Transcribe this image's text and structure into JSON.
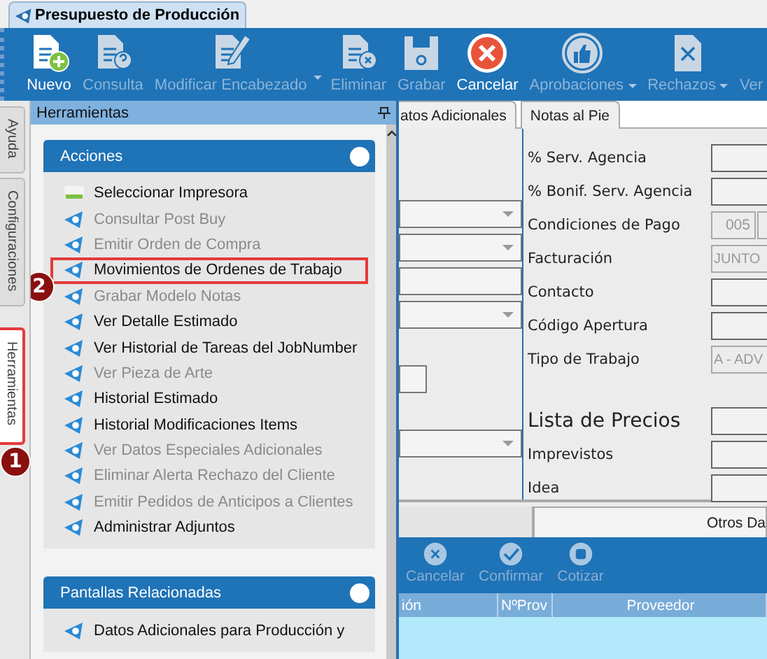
{
  "document_tab": {
    "title": "Presupuesto de Producción"
  },
  "toolbar": [
    {
      "label": "Nuevo",
      "kind": "new",
      "disabled": false
    },
    {
      "label": "Consulta",
      "kind": "query",
      "disabled": true
    },
    {
      "label": "Modificar Encabezado",
      "kind": "edit",
      "disabled": true,
      "split": true
    },
    {
      "label": "Eliminar",
      "kind": "delete",
      "disabled": true
    },
    {
      "label": "Grabar",
      "kind": "save",
      "disabled": true
    },
    {
      "label": "Cancelar",
      "kind": "cancel",
      "disabled": false
    },
    {
      "label": "Aprobaciones",
      "kind": "approve",
      "disabled": true,
      "dropdown": true
    },
    {
      "label": "Rechazos",
      "kind": "reject",
      "disabled": true,
      "dropdown": true
    },
    {
      "label": "Ver",
      "kind": "none",
      "disabled": true
    }
  ],
  "side_tabs": [
    {
      "label": "Ayuda",
      "selected": false
    },
    {
      "label": "Configuraciones",
      "selected": false
    },
    {
      "label": "Herramientas",
      "selected": true,
      "callout": "1"
    }
  ],
  "panel": {
    "title": "Herramientas",
    "sections": [
      {
        "title": "Acciones",
        "items": [
          {
            "label": "Seleccionar Impresora",
            "kind": "printer",
            "disabled": false
          },
          {
            "label": "Consultar Post Buy",
            "kind": "app",
            "disabled": true
          },
          {
            "label": "Emitir Orden de Compra",
            "kind": "app",
            "disabled": true
          },
          {
            "label": "Movimientos de Ordenes de Trabajo",
            "kind": "app",
            "disabled": false,
            "callout": "2"
          },
          {
            "label": "Grabar Modelo Notas",
            "kind": "app",
            "disabled": true
          },
          {
            "label": "Ver Detalle Estimado",
            "kind": "app",
            "disabled": false
          },
          {
            "label": "Ver Historial de Tareas del JobNumber",
            "kind": "app",
            "disabled": false
          },
          {
            "label": "Ver Pieza de Arte",
            "kind": "app",
            "disabled": true
          },
          {
            "label": "Historial Estimado",
            "kind": "app",
            "disabled": false
          },
          {
            "label": "Historial Modificaciones Items",
            "kind": "app",
            "disabled": false
          },
          {
            "label": "Ver Datos Especiales Adicionales",
            "kind": "app",
            "disabled": true
          },
          {
            "label": "Eliminar Alerta Rechazo del Cliente",
            "kind": "app",
            "disabled": true
          },
          {
            "label": "Emitir Pedidos de Anticipos a Clientes",
            "kind": "app",
            "disabled": true
          },
          {
            "label": "Administrar Adjuntos",
            "kind": "app",
            "disabled": false
          }
        ]
      },
      {
        "title": "Pantallas Relacionadas",
        "items": [
          {
            "label": "Datos Adicionales para Producción y",
            "kind": "app",
            "disabled": false
          }
        ]
      }
    ]
  },
  "form": {
    "tabs": [
      {
        "label": "atos Adicionales",
        "selected": false
      },
      {
        "label": "Notas al Pie",
        "selected": false
      }
    ],
    "left_fields": [
      {
        "kind": "dropdown"
      },
      {
        "kind": "dropdown"
      },
      {
        "kind": "text"
      },
      {
        "kind": "dropdown"
      },
      {
        "kind": "gap"
      },
      {
        "kind": "small"
      },
      {
        "kind": "gap"
      },
      {
        "kind": "dropdown"
      }
    ],
    "right_fields": [
      {
        "label": "% Serv. Agencia",
        "kind": "text"
      },
      {
        "label": "% Bonif. Serv. Agencia",
        "kind": "text"
      },
      {
        "label": "Condiciones de Pago",
        "kind": "code",
        "value": "005"
      },
      {
        "label": "Facturación",
        "kind": "readonly",
        "value": "JUNTO"
      },
      {
        "label": "Contacto",
        "kind": "text"
      },
      {
        "label": "Código Apertura",
        "kind": "text"
      },
      {
        "label": "Tipo de Trabajo",
        "kind": "readonly",
        "value": "A - ADV"
      },
      {
        "label": "Lista de Precios",
        "kind": "heading"
      },
      {
        "label": "Imprevistos",
        "kind": "text"
      },
      {
        "label": "Idea",
        "kind": "text"
      }
    ]
  },
  "bottom_tabs": [
    {
      "label": "Otros Da",
      "selected": false
    }
  ],
  "grid_toolbar": [
    {
      "label": "Cancelar",
      "kind": "cancel",
      "disabled": true
    },
    {
      "label": "Confirmar",
      "kind": "confirm",
      "disabled": true
    },
    {
      "label": "Cotizar",
      "kind": "quote",
      "disabled": true
    }
  ],
  "grid": {
    "columns": [
      "ión",
      "NºProv",
      "Proveedor"
    ]
  }
}
